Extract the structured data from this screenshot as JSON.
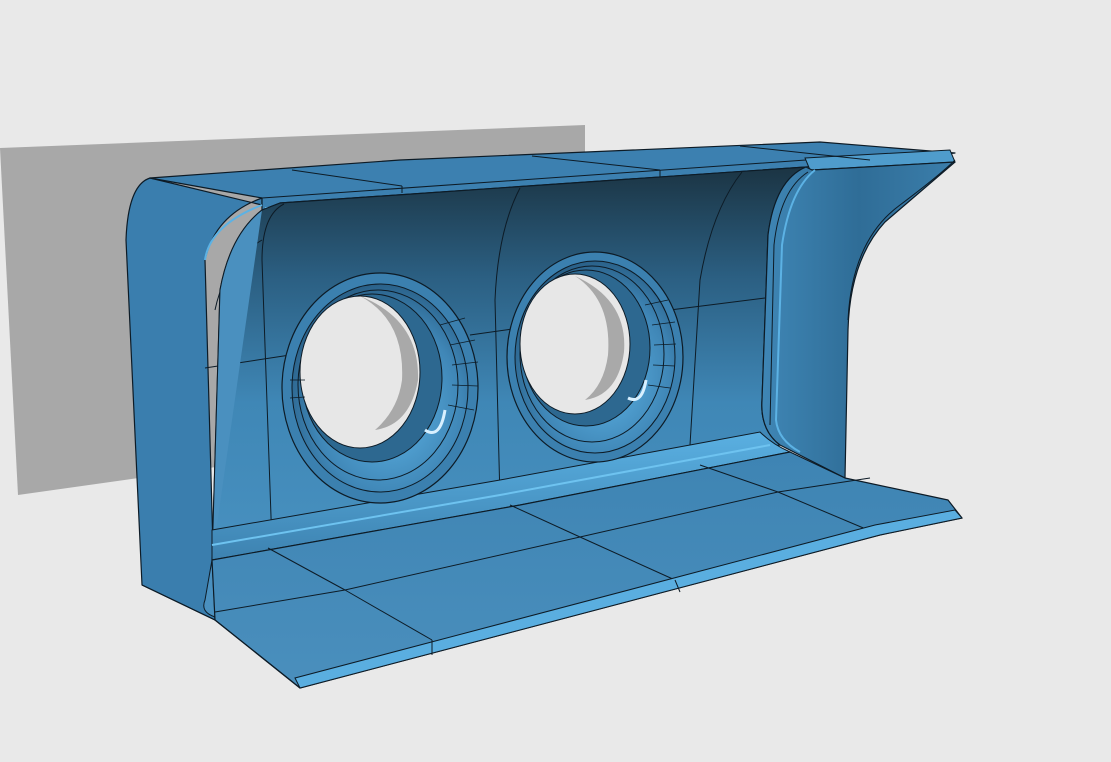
{
  "scene": {
    "background_color": "#e9e9e9",
    "shadow_color": "#a9a9a9",
    "part_colors": {
      "base": "#4a8fbd",
      "outer": "#3c7fae",
      "dark_inside": "#1f3d4f",
      "mid": "#2f6a92",
      "highlight": "#5eb4e6",
      "edge": "#0d1b26"
    },
    "object_kind": "bracket-with-two-holes-icon",
    "hole_count": 2
  }
}
